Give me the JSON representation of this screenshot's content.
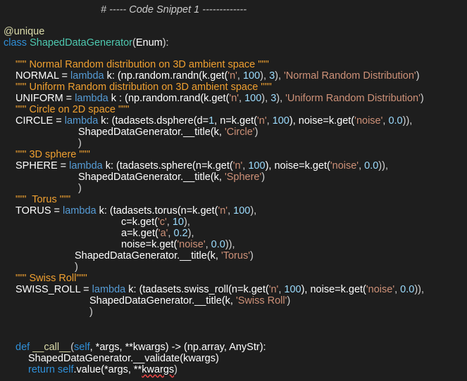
{
  "lines": [
    {
      "tokens": [
        {
          "c": "cmt",
          "t": "# ----- Code Snippet 1 -------------"
        }
      ]
    },
    {
      "tokens": []
    },
    {
      "tokens": [
        {
          "c": "dec",
          "t": "@unique"
        }
      ]
    },
    {
      "tokens": [
        {
          "c": "kw",
          "t": "class "
        },
        {
          "c": "cls",
          "t": "ShapedDataGenerator"
        },
        {
          "c": "pun",
          "t": "("
        },
        {
          "c": "id",
          "t": "Enum"
        },
        {
          "c": "pun",
          "t": "):"
        }
      ]
    },
    {
      "tokens": []
    },
    {
      "tokens": [
        {
          "c": "docstr",
          "t": "\"\"\" Normal Random distribution on 3D ambient space \"\"\""
        }
      ]
    },
    {
      "tokens": [
        {
          "c": "id",
          "t": "NORMAL = "
        },
        {
          "c": "lam",
          "t": "lambda"
        },
        {
          "c": "id",
          "t": " k: (np.random.randn(k.get("
        },
        {
          "c": "str",
          "t": "'n'"
        },
        {
          "c": "pun",
          "t": ", "
        },
        {
          "c": "num",
          "t": "100"
        },
        {
          "c": "pun",
          "t": "), "
        },
        {
          "c": "num",
          "t": "3"
        },
        {
          "c": "pun",
          "t": "), "
        },
        {
          "c": "str",
          "t": "'Normal Random Distribution'"
        },
        {
          "c": "pun",
          "t": ")"
        }
      ]
    },
    {
      "tokens": [
        {
          "c": "docstr",
          "t": "\"\"\" Uniform Random distribution on 3D ambient space \"\"\""
        }
      ]
    },
    {
      "tokens": [
        {
          "c": "id",
          "t": "UNIFORM = "
        },
        {
          "c": "lam",
          "t": "lambda"
        },
        {
          "c": "id",
          "t": " k : (np.random.rand(k.get("
        },
        {
          "c": "str",
          "t": "'n'"
        },
        {
          "c": "pun",
          "t": ", "
        },
        {
          "c": "num",
          "t": "100"
        },
        {
          "c": "pun",
          "t": "), "
        },
        {
          "c": "num",
          "t": "3"
        },
        {
          "c": "pun",
          "t": "), "
        },
        {
          "c": "str",
          "t": "'Uniform Random Distribution'"
        },
        {
          "c": "pun",
          "t": ")"
        }
      ]
    },
    {
      "tokens": [
        {
          "c": "docstr",
          "t": "\"\"\" Circle on 2D space \"\"\""
        }
      ]
    },
    {
      "tokens": [
        {
          "c": "id",
          "t": "CIRCLE = "
        },
        {
          "c": "lam",
          "t": "lambda"
        },
        {
          "c": "id",
          "t": " k: (tadasets.dsphere(d="
        },
        {
          "c": "num",
          "t": "1"
        },
        {
          "c": "id",
          "t": ", n=k.get("
        },
        {
          "c": "str",
          "t": "'n'"
        },
        {
          "c": "pun",
          "t": ", "
        },
        {
          "c": "num",
          "t": "100"
        },
        {
          "c": "id",
          "t": "), noise=k.get("
        },
        {
          "c": "str",
          "t": "'noise'"
        },
        {
          "c": "pun",
          "t": ", "
        },
        {
          "c": "num",
          "t": "0.0"
        },
        {
          "c": "pun",
          "t": ")),"
        }
      ]
    },
    {
      "tokens": [
        {
          "c": "id",
          "t": "ShapedDataGenerator.__title(k, "
        },
        {
          "c": "str",
          "t": "'Circle'"
        },
        {
          "c": "pun",
          "t": ")"
        }
      ]
    },
    {
      "tokens": [
        {
          "c": "pun",
          "t": ")"
        }
      ]
    },
    {
      "tokens": [
        {
          "c": "docstr",
          "t": "\"\"\" 3D sphere \"\"\""
        }
      ]
    },
    {
      "tokens": [
        {
          "c": "id",
          "t": "SPHERE = "
        },
        {
          "c": "lam",
          "t": "lambda"
        },
        {
          "c": "id",
          "t": " k: (tadasets.sphere(n=k.get("
        },
        {
          "c": "str",
          "t": "'n'"
        },
        {
          "c": "pun",
          "t": ", "
        },
        {
          "c": "num",
          "t": "100"
        },
        {
          "c": "id",
          "t": "), noise=k.get("
        },
        {
          "c": "str",
          "t": "'noise'"
        },
        {
          "c": "pun",
          "t": ", "
        },
        {
          "c": "num",
          "t": "0.0"
        },
        {
          "c": "pun",
          "t": ")),"
        }
      ]
    },
    {
      "tokens": [
        {
          "c": "id",
          "t": "ShapedDataGenerator.__title(k, "
        },
        {
          "c": "str",
          "t": "'Sphere'"
        },
        {
          "c": "pun",
          "t": ")"
        }
      ]
    },
    {
      "tokens": [
        {
          "c": "pun",
          "t": ")"
        }
      ]
    },
    {
      "tokens": [
        {
          "c": "docstr",
          "t": "\"\"\"  Torus \"\"\""
        }
      ]
    },
    {
      "tokens": [
        {
          "c": "id",
          "t": "TORUS = "
        },
        {
          "c": "lam",
          "t": "lambda"
        },
        {
          "c": "id",
          "t": " k: (tadasets.torus(n=k.get("
        },
        {
          "c": "str",
          "t": "'n'"
        },
        {
          "c": "pun",
          "t": ", "
        },
        {
          "c": "num",
          "t": "100"
        },
        {
          "c": "pun",
          "t": "),"
        }
      ]
    },
    {
      "tokens": [
        {
          "c": "id",
          "t": "c=k.get("
        },
        {
          "c": "str",
          "t": "'c'"
        },
        {
          "c": "pun",
          "t": ", "
        },
        {
          "c": "num",
          "t": "10"
        },
        {
          "c": "pun",
          "t": "),"
        }
      ]
    },
    {
      "tokens": [
        {
          "c": "id",
          "t": "a=k.get("
        },
        {
          "c": "str",
          "t": "'a'"
        },
        {
          "c": "pun",
          "t": ", "
        },
        {
          "c": "num",
          "t": "0.2"
        },
        {
          "c": "pun",
          "t": "),"
        }
      ]
    },
    {
      "tokens": [
        {
          "c": "id",
          "t": "noise=k.get("
        },
        {
          "c": "str",
          "t": "'noise'"
        },
        {
          "c": "pun",
          "t": ", "
        },
        {
          "c": "num",
          "t": "0.0"
        },
        {
          "c": "pun",
          "t": ")),"
        }
      ]
    },
    {
      "tokens": [
        {
          "c": "id",
          "t": "ShapedDataGenerator.__title(k, "
        },
        {
          "c": "str",
          "t": "'Torus'"
        },
        {
          "c": "pun",
          "t": ")"
        }
      ]
    },
    {
      "tokens": [
        {
          "c": "pun",
          "t": ")"
        }
      ]
    },
    {
      "tokens": [
        {
          "c": "docstr",
          "t": "\"\"\" Swiss Roll\"\"\""
        }
      ]
    },
    {
      "tokens": [
        {
          "c": "id",
          "t": "SWISS_ROLL = "
        },
        {
          "c": "lam",
          "t": "lambda"
        },
        {
          "c": "id",
          "t": " k: (tadasets.swiss_roll(n=k.get("
        },
        {
          "c": "str",
          "t": "'n'"
        },
        {
          "c": "pun",
          "t": ", "
        },
        {
          "c": "num",
          "t": "100"
        },
        {
          "c": "id",
          "t": "), noise=k.get("
        },
        {
          "c": "str",
          "t": "'noise'"
        },
        {
          "c": "pun",
          "t": ", "
        },
        {
          "c": "num",
          "t": "0.0"
        },
        {
          "c": "pun",
          "t": ")),"
        }
      ]
    },
    {
      "tokens": [
        {
          "c": "id",
          "t": "ShapedDataGenerator.__title(k, "
        },
        {
          "c": "str",
          "t": "'Swiss Roll'"
        },
        {
          "c": "pun",
          "t": ")"
        }
      ]
    },
    {
      "tokens": [
        {
          "c": "pun",
          "t": ")"
        }
      ]
    },
    {
      "tokens": []
    },
    {
      "tokens": []
    },
    {
      "tokens": [
        {
          "c": "kw",
          "t": "def "
        },
        {
          "c": "fn",
          "t": "__call__"
        },
        {
          "c": "pun",
          "t": "("
        },
        {
          "c": "kw",
          "t": "self"
        },
        {
          "c": "id",
          "t": ", *args, **kwargs) -> (np.array, AnyStr):"
        }
      ]
    },
    {
      "tokens": [
        {
          "c": "id",
          "t": "ShapedDataGenerator.__validate(kwargs)"
        }
      ]
    },
    {
      "tokens": [
        {
          "c": "kw",
          "t": "return "
        },
        {
          "c": "kw",
          "t": "self"
        },
        {
          "c": "id",
          "t": ".value(*args, **"
        },
        {
          "c": "id squig",
          "t": "kwargs"
        },
        {
          "c": "pun",
          "t": ")"
        }
      ]
    }
  ]
}
